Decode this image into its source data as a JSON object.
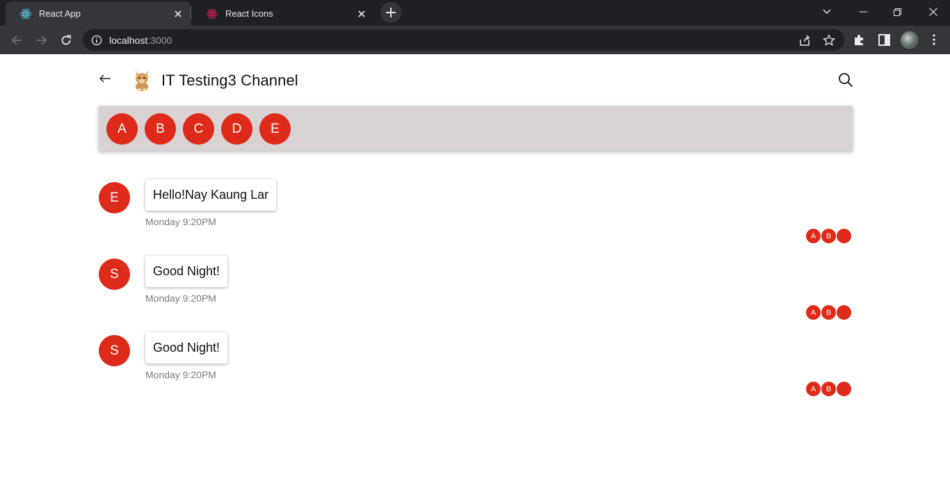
{
  "browser": {
    "tabs": [
      {
        "label": "React App",
        "active": true
      },
      {
        "label": "React Icons",
        "active": false
      }
    ],
    "url_host": "localhost",
    "url_port": ":3000"
  },
  "header": {
    "channel_title": "IT Testing3 Channel"
  },
  "members": [
    "A",
    "B",
    "C",
    "D",
    "E"
  ],
  "messages": [
    {
      "avatar": "E",
      "text": "Hello!Nay Kaung Lar",
      "time": "Monday 9:20PM",
      "readers": [
        "A",
        "B",
        ""
      ]
    },
    {
      "avatar": "S",
      "text": "Good Night!",
      "time": "Monday 9:20PM",
      "readers": [
        "A",
        "B",
        ""
      ]
    },
    {
      "avatar": "S",
      "text": "Good Night!",
      "time": "Monday 9:20PM",
      "readers": [
        "A",
        "B",
        ""
      ]
    }
  ],
  "colors": {
    "accent": "#de2a1a",
    "members_bar_bg": "#d8d2d2",
    "chrome_dark": "#202124",
    "chrome_toolbar": "#35363a"
  }
}
